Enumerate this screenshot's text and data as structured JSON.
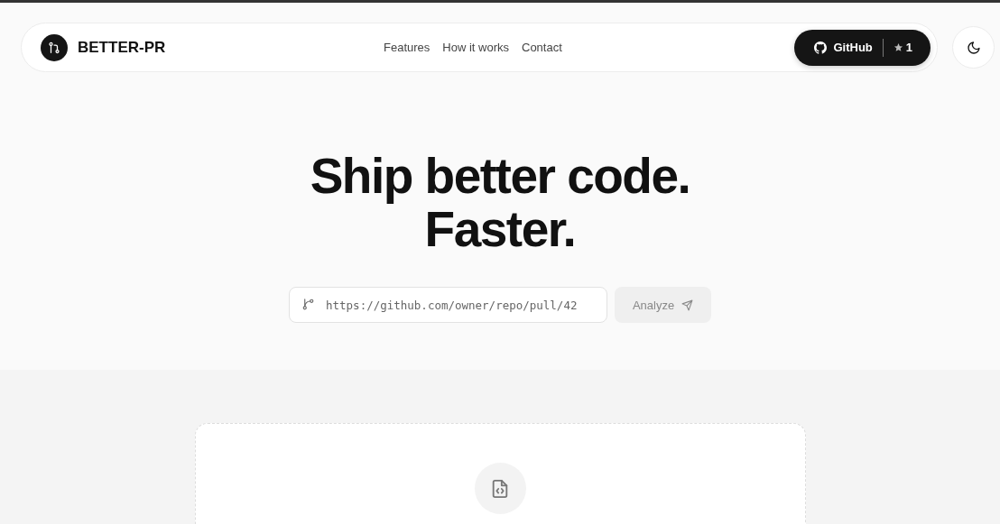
{
  "brand": {
    "name": "BETTER-PR"
  },
  "nav": [
    "Features",
    "How it works",
    "Contact"
  ],
  "github": {
    "label": "GitHub",
    "stars_count": "1"
  },
  "hero": {
    "lines": [
      "Ship better code.",
      "Faster."
    ]
  },
  "pr_input": {
    "placeholder": "https://github.com/owner/repo/pull/42"
  },
  "analyze_button": {
    "label": "Analyze",
    "disabled": true
  }
}
